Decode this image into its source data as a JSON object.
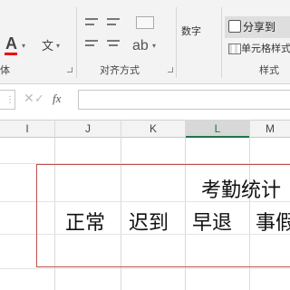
{
  "ribbon": {
    "font_group_label": "体",
    "alignment_group_label": "对齐方式",
    "number_label": "数字",
    "share_label": "分享到",
    "cell_style_label": "单元格样式",
    "styles_group_label": "样式",
    "font_color_glyph": "A",
    "phonetic_glyph": "文",
    "orientation_glyph": "ab"
  },
  "formula_bar": {
    "cancel_glyph": "✕",
    "enter_glyph": "✓",
    "fx_label": "fx",
    "formula_value": ""
  },
  "columns": [
    "I",
    "J",
    "K",
    "L",
    "M"
  ],
  "selected_column": "L",
  "sheet": {
    "title": "考勤统计",
    "headers": [
      "正常",
      "迟到",
      "早退",
      "事假"
    ]
  },
  "colors": {
    "accent": "#217346",
    "border_red": "#c0504d",
    "font_color": "#ff0000"
  }
}
